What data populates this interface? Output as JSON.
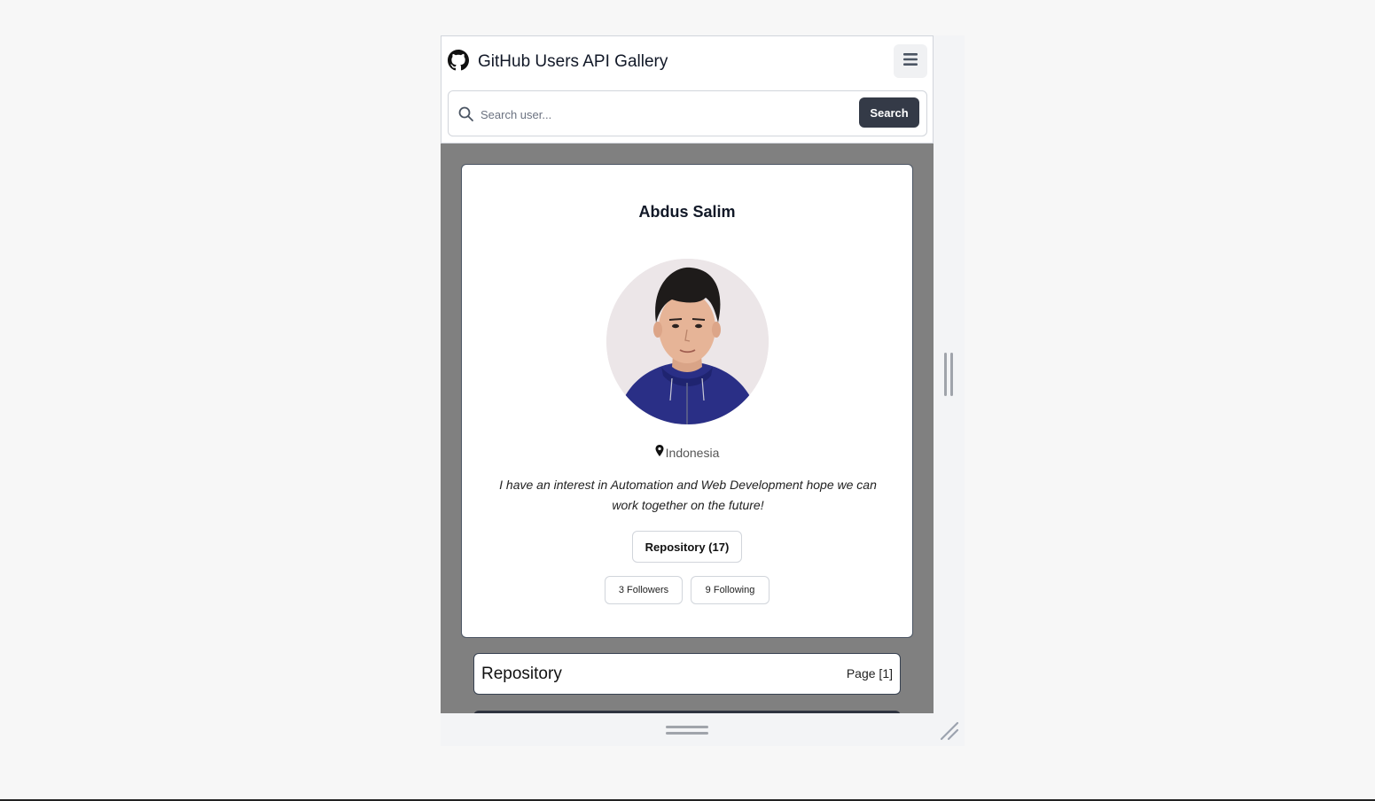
{
  "app": {
    "title": "GitHub Users API Gallery",
    "icon": "github-icon"
  },
  "navbar": {
    "menu_icon": "hamburger-icon"
  },
  "search": {
    "placeholder": "Search user...",
    "value": "",
    "button_label": "Search",
    "icon": "search-icon"
  },
  "profile": {
    "name": "Abdus Salim",
    "location": "Indonesia",
    "location_icon": "map-pin-icon",
    "bio": "I have an interest in Automation and Web Development hope we can work together on the future!",
    "repository_button": "Repository (17)",
    "followers_label": "3 Followers",
    "following_label": "9 Following"
  },
  "repository_section": {
    "title": "Repository",
    "page_label": "Page [1]"
  },
  "colors": {
    "viewport_background": "#808080",
    "search_button": "#343a47",
    "card_border": "#4b5563"
  }
}
